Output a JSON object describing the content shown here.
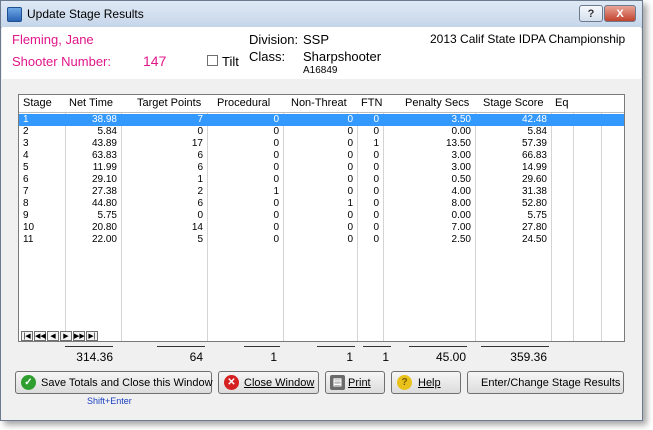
{
  "window": {
    "title": "Update Stage Results",
    "help_label": "?",
    "close_label": "X"
  },
  "shooter": {
    "name": "Fleming, Jane",
    "number_label": "Shooter Number:",
    "number": "147",
    "tilt_label": "Tilt",
    "tilt_checked": false
  },
  "division": {
    "label": "Division:",
    "value": "SSP"
  },
  "class": {
    "label": "Class:",
    "value": "Sharpshooter",
    "id": "A16849"
  },
  "event": {
    "name": "2013 Calif State IDPA Championship"
  },
  "table": {
    "columns": [
      "Stage",
      "Net Time",
      "Target Points",
      "Procedural",
      "Non-Threat",
      "FTN",
      "Penalty Secs",
      "Stage Score",
      "Eq"
    ],
    "rows": [
      [
        "1",
        "38.98",
        "7",
        "0",
        "0",
        "0",
        "3.50",
        "42.48"
      ],
      [
        "2",
        "5.84",
        "0",
        "0",
        "0",
        "0",
        "0.00",
        "5.84"
      ],
      [
        "3",
        "43.89",
        "17",
        "0",
        "0",
        "1",
        "13.50",
        "57.39"
      ],
      [
        "4",
        "63.83",
        "6",
        "0",
        "0",
        "0",
        "3.00",
        "66.83"
      ],
      [
        "5",
        "11.99",
        "6",
        "0",
        "0",
        "0",
        "3.00",
        "14.99"
      ],
      [
        "6",
        "29.10",
        "1",
        "0",
        "0",
        "0",
        "0.50",
        "29.60"
      ],
      [
        "7",
        "27.38",
        "2",
        "1",
        "0",
        "0",
        "4.00",
        "31.38"
      ],
      [
        "8",
        "44.80",
        "6",
        "0",
        "1",
        "0",
        "8.00",
        "52.80"
      ],
      [
        "9",
        "5.75",
        "0",
        "0",
        "0",
        "0",
        "0.00",
        "5.75"
      ],
      [
        "10",
        "20.80",
        "14",
        "0",
        "0",
        "0",
        "7.00",
        "27.80"
      ],
      [
        "11",
        "22.00",
        "5",
        "0",
        "0",
        "0",
        "2.50",
        "24.50"
      ]
    ],
    "selected_row": 0
  },
  "nav_icons": [
    "first-icon",
    "prev-page-icon",
    "prev-icon",
    "next-icon",
    "next-page-icon",
    "last-icon"
  ],
  "totals": {
    "net_time": "314.36",
    "target_points": "64",
    "procedural": "1",
    "non_threat": "1",
    "ftn": "1",
    "penalty_secs": "45.00",
    "stage_score": "359.36"
  },
  "buttons": {
    "save": "Save Totals and Close this Window",
    "save_hint": "Shift+Enter",
    "close": "Close Window",
    "print": "Print",
    "help": "Help",
    "enter": "Enter/Change Stage Results"
  },
  "colors": {
    "accent_pink": "#e0178a",
    "selection": "#3399ff"
  }
}
